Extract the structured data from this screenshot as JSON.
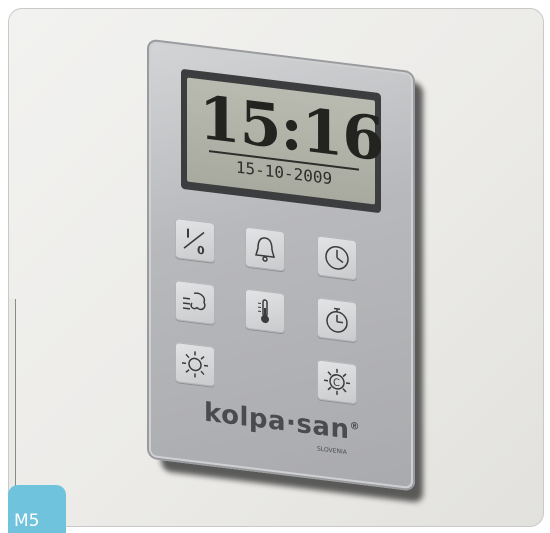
{
  "display": {
    "time": "15:16",
    "date": "15-10-2009"
  },
  "brand": {
    "name": "kolpa·san",
    "registered": "®",
    "sub": "SLOVENIA"
  },
  "badge": {
    "label": "M5"
  },
  "buttons": [
    {
      "icon": "power-icon",
      "label": "1/0"
    },
    {
      "icon": "bell-icon"
    },
    {
      "icon": "clock-icon"
    },
    {
      "icon": "fan-icon"
    },
    {
      "icon": "thermometer-icon"
    },
    {
      "icon": "timer-icon"
    },
    {
      "icon": "sun-icon"
    },
    {
      "icon": "sun-c-icon",
      "label": "C"
    }
  ],
  "colors": {
    "device": "#b8b9bc",
    "lcd": "#b9bbb0",
    "badge": "#6fc3dc"
  }
}
